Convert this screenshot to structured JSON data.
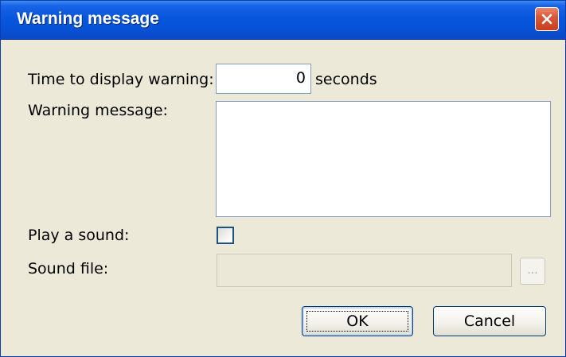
{
  "window": {
    "title": "Warning message"
  },
  "form": {
    "time_label": "Time to display warning:",
    "time_value": "0",
    "time_unit": "seconds",
    "message_label": "Warning message:",
    "message_value": "",
    "sound_label": "Play a sound:",
    "sound_checked": false,
    "sound_file_label": "Sound file:",
    "sound_file_value": "",
    "browse_label": "..."
  },
  "buttons": {
    "ok": "OK",
    "cancel": "Cancel"
  },
  "colors": {
    "titlebar": "#0756dc",
    "dialog_bg": "#ece9d8",
    "field_border": "#7f9db9",
    "close_button": "#d9583a"
  }
}
